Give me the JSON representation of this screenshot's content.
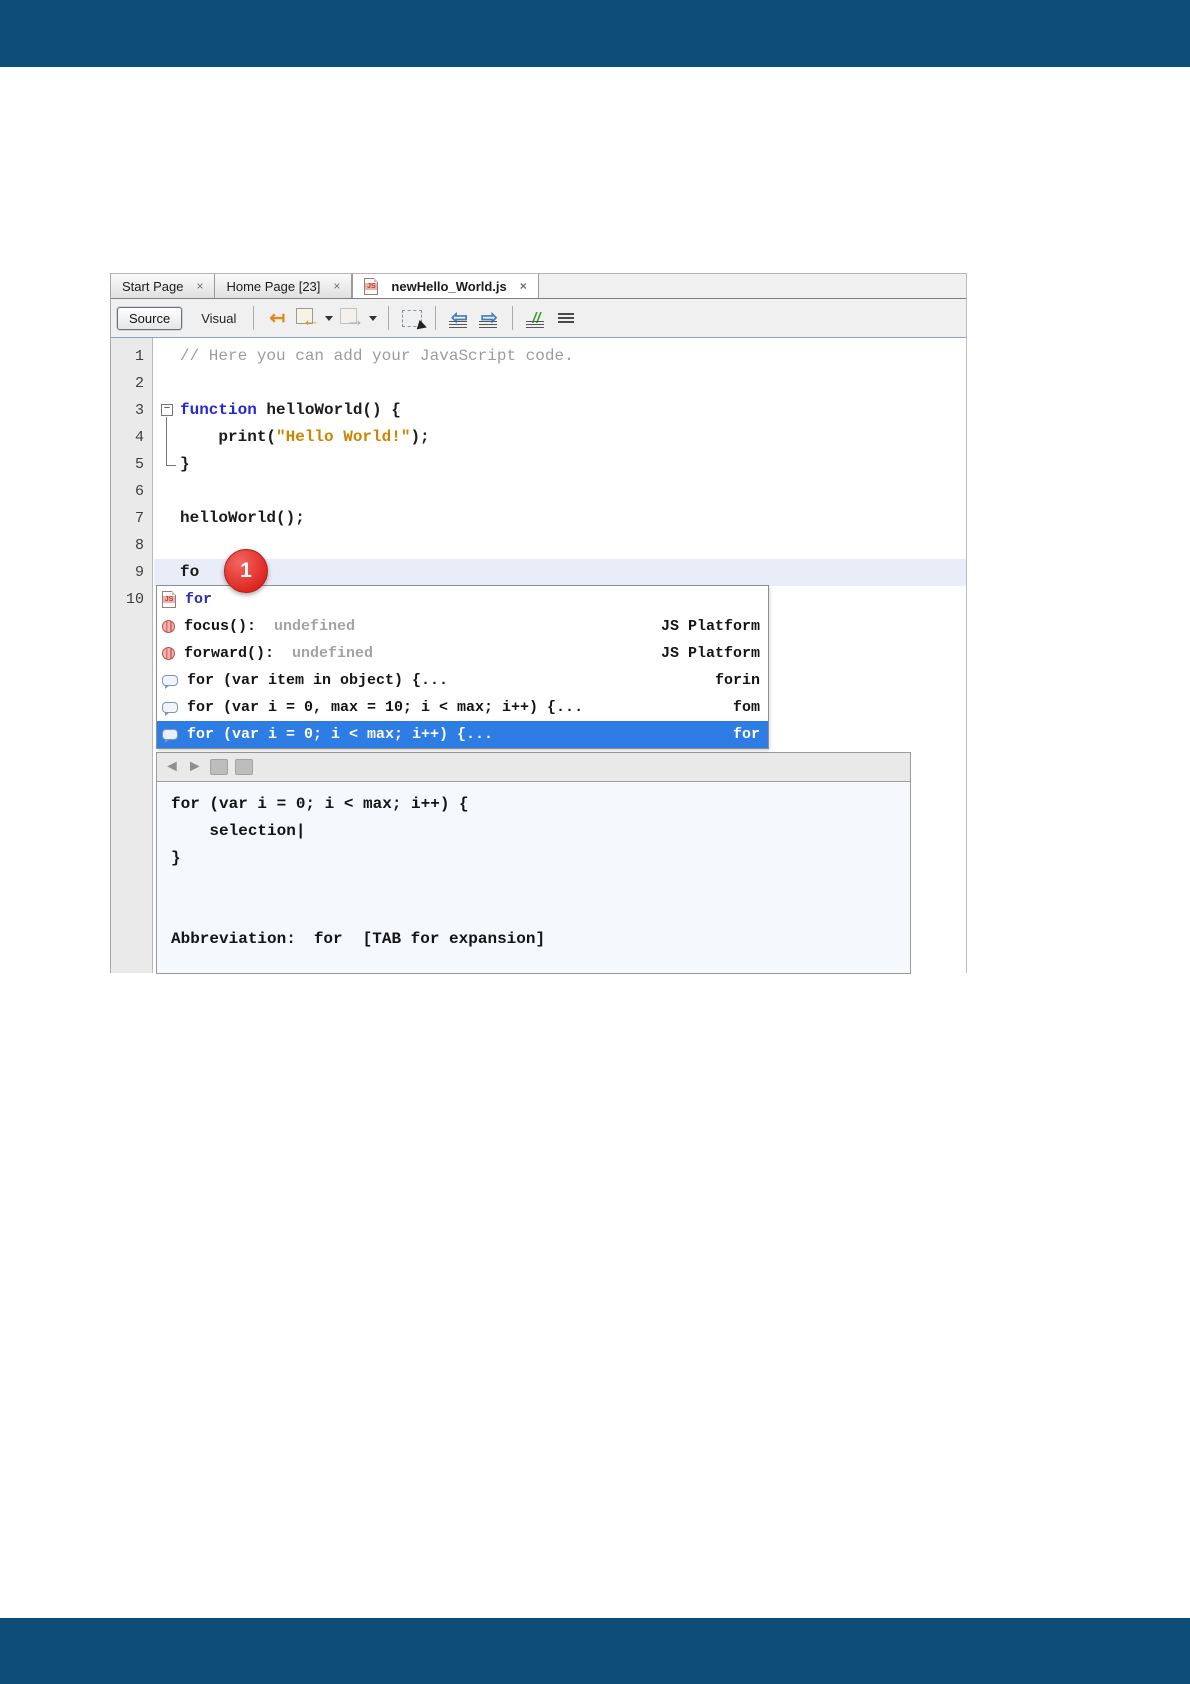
{
  "page": {
    "top_bar_color": "#0e4d78",
    "bottom_bar_color": "#0e4d78"
  },
  "tabs": {
    "close_glyph": "×",
    "items": [
      {
        "label": "Start Page",
        "active": false
      },
      {
        "label": "Home Page [23]",
        "active": false
      },
      {
        "label": "newHello_World.js",
        "active": true,
        "icon": "js-file-icon"
      }
    ]
  },
  "toolbar": {
    "source_label": "Source",
    "visual_label": "Visual",
    "icons": {
      "jump_last_edit_glyph": "↤",
      "back_glyph": "←",
      "forward_glyph": "→",
      "shift_left_glyph": "⇦",
      "shift_right_glyph": "⇨",
      "comment_glyph": "//"
    }
  },
  "gutter": [
    "1",
    "2",
    "3",
    "4",
    "5",
    "6",
    "7",
    "8",
    "9",
    "10"
  ],
  "code": {
    "fold_glyph": "−",
    "line1_comment": "// Here you can add your JavaScript code.",
    "line3_keyword": "function",
    "line3_rest": " helloWorld() {",
    "line4_pre": "    print(",
    "line4_string": "\"Hello World!\"",
    "line4_post": ");",
    "line5": "}",
    "line7": "helloWorld();",
    "line9": "fo"
  },
  "badge": {
    "label": "1",
    "color": "#dc2420"
  },
  "completion": {
    "selection_color": "#2d7de4",
    "rows": [
      {
        "text": "for",
        "right": ""
      },
      {
        "name": "focus():",
        "type": "undefined",
        "right": "JS Platform"
      },
      {
        "name": "forward():",
        "type": "undefined",
        "right": "JS Platform"
      },
      {
        "text": "for (var item in object) {...",
        "right": "forin"
      },
      {
        "text": "for (var i = 0, max = 10; i < max; i++) {...",
        "right": "fom"
      },
      {
        "text": "for (var i = 0; i < max; i++) {...",
        "right": "for",
        "selected": true
      }
    ]
  },
  "doc": {
    "code_line1": "for (var i = 0; i < max; i++) {",
    "code_line2_indent": "    ",
    "code_line2_word": "selection",
    "code_line2_caret": "|",
    "code_line3": "}",
    "abbrev_label": "Abbreviation:",
    "abbrev_value": "for",
    "abbrev_hint": "[TAB for expansion]"
  },
  "colors": {
    "keyword_blue": "#2329d6",
    "string_orange": "#ce8500",
    "comment_gray": "#9c9c9c",
    "line_highlight": "#e8edf8"
  }
}
